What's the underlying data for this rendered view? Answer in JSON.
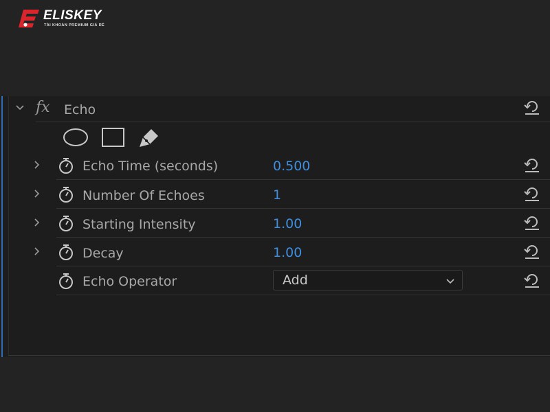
{
  "logo": {
    "name": "ELISKEY",
    "tagline": "TÀI KHOẢN PREMIUM GIÁ RẺ",
    "brand_color": "#d9262c"
  },
  "effect": {
    "name": "Echo",
    "fx_symbol": "fx",
    "mask_tools": [
      "ellipse-mask-icon",
      "rectangle-mask-icon",
      "pen-mask-icon"
    ]
  },
  "properties": [
    {
      "label": "Echo Time (seconds)",
      "value": "0.500",
      "expandable": true
    },
    {
      "label": "Number Of Echoes",
      "value": "1",
      "expandable": true
    },
    {
      "label": "Starting Intensity",
      "value": "1.00",
      "expandable": true
    },
    {
      "label": "Decay",
      "value": "1.00",
      "expandable": true
    }
  ],
  "operator": {
    "label": "Echo Operator",
    "selected": "Add"
  },
  "colors": {
    "value_blue": "#3f8ee0",
    "panel_bg": "#1d1d1d",
    "accent_line": "#2f6db8"
  }
}
